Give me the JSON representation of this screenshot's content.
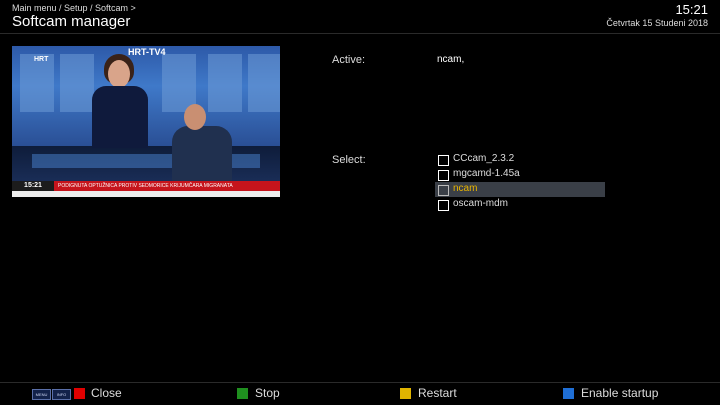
{
  "header": {
    "breadcrumb": "Main menu / Setup / Softcam >",
    "title": "Softcam manager",
    "time": "15:21",
    "date": "Četvrtak 15 Studeni 2018"
  },
  "preview": {
    "channel_logo": "HRT-TV4",
    "corner_logo": "HRT",
    "ticker_time": "15:21",
    "ticker_text": "PODIGNUTA OPTUŽNICA PROTIV SEDMORICE KRIJUMČARA MIGRANATA"
  },
  "info": {
    "active_label": "Active:",
    "active_value": "ncam,",
    "select_label": "Select:"
  },
  "softcams": [
    {
      "name": "CCcam_2.3.2",
      "checked": false,
      "selected": false
    },
    {
      "name": "mgcamd-1.45a",
      "checked": false,
      "selected": false
    },
    {
      "name": "ncam",
      "checked": false,
      "selected": true
    },
    {
      "name": "oscam-mdm",
      "checked": false,
      "selected": false
    }
  ],
  "footer": {
    "menu_key": "MENU",
    "info_key": "INFO",
    "buttons": [
      {
        "color": "#e00000",
        "label": "Close"
      },
      {
        "color": "#1f8f1f",
        "label": "Stop"
      },
      {
        "color": "#e0b400",
        "label": "Restart"
      },
      {
        "color": "#1f6fd6",
        "label": "Enable startup"
      }
    ]
  },
  "colors": {
    "selected_text": "#e8b400",
    "selected_bg": "#3a3f47"
  }
}
